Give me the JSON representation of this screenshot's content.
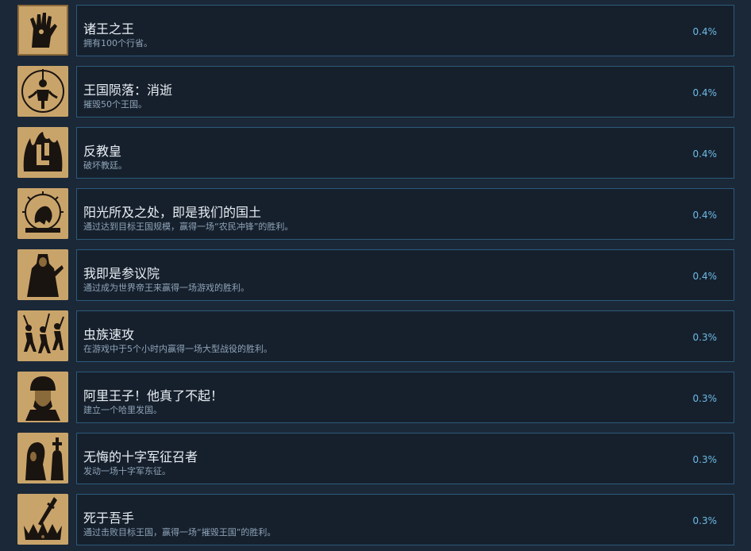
{
  "colors": {
    "background": "#1b2838",
    "row_border": "#2c5a78",
    "title": "#e8eef4",
    "description": "#8ea3b6",
    "percentage": "#6dbbe6",
    "icon_parchment": "#c9a46a",
    "icon_ink": "#1a1410"
  },
  "achievements": [
    {
      "title": "诸王之王",
      "description": "拥有100个行省。",
      "percent": "0.4%",
      "icon": "raised-hand-icon"
    },
    {
      "title": "王国陨落：消逝",
      "description": "摧毁50个王国。",
      "percent": "0.4%",
      "icon": "hanging-figure-icon"
    },
    {
      "title": "反教皇",
      "description": "破坏教廷。",
      "percent": "0.4%",
      "icon": "burning-letter-icon"
    },
    {
      "title": "阳光所及之处，即是我们的国土",
      "description": "通过达到目标王国规模，赢得一场“农民冲锋”的胜利。",
      "percent": "0.4%",
      "icon": "lion-sun-icon"
    },
    {
      "title": "我即是参议院",
      "description": "通过成为世界帝王来赢得一场游戏的胜利。",
      "percent": "0.4%",
      "icon": "robed-emperor-icon"
    },
    {
      "title": "虫族速攻",
      "description": "在游戏中于5个小时内赢得一场大型战役的胜利。",
      "percent": "0.3%",
      "icon": "charging-peasants-icon"
    },
    {
      "title": "阿里王子！他真了不起！",
      "description": "建立一个哈里发国。",
      "percent": "0.3%",
      "icon": "turbaned-prince-icon"
    },
    {
      "title": "无悔的十字军征召者",
      "description": "发动一场十字军东征。",
      "percent": "0.3%",
      "icon": "crusader-preacher-icon"
    },
    {
      "title": "死于吾手",
      "description": "通过击败目标王国，赢得一场“摧毁王国”的胜利。",
      "percent": "0.3%",
      "icon": "sword-crown-icon"
    }
  ]
}
